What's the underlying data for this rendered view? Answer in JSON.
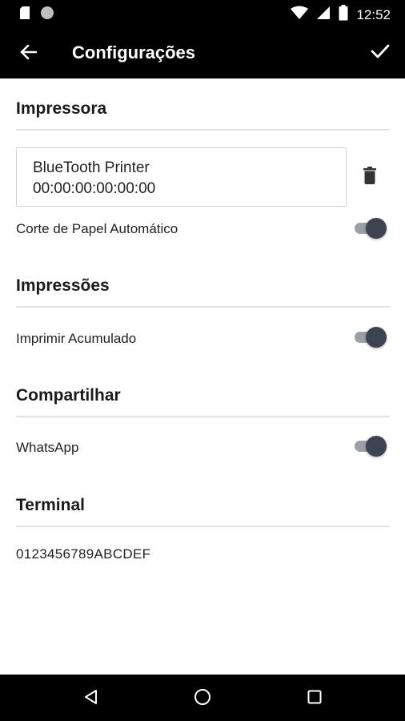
{
  "status_bar": {
    "time": "12:52",
    "icons": [
      "sd-card-icon",
      "circle-notification-icon",
      "wifi-icon",
      "signal-icon",
      "battery-icon"
    ]
  },
  "app_bar": {
    "title": "Configurações",
    "back_icon": "arrow-left-icon",
    "confirm_icon": "check-icon"
  },
  "sections": {
    "printer": {
      "title": "Impressora",
      "device_name": "BlueTooth Printer",
      "device_address": "00:00:00:00:00:00",
      "delete_icon": "trash-icon",
      "auto_cut_label": "Corte de Papel Automático",
      "auto_cut_enabled": true
    },
    "prints": {
      "title": "Impressões",
      "accumulated_label": "Imprimir Acumulado",
      "accumulated_enabled": true
    },
    "share": {
      "title": "Compartilhar",
      "whatsapp_label": "WhatsApp",
      "whatsapp_enabled": true
    },
    "terminal": {
      "title": "Terminal",
      "value": "0123456789ABCDEF"
    }
  },
  "nav_bar": {
    "icons": [
      "back-triangle-icon",
      "home-circle-icon",
      "recents-square-icon"
    ]
  },
  "colors": {
    "bars": "#000000",
    "toggle_thumb": "#3d4350",
    "toggle_track": "#9aa0a8",
    "divider": "#e3e3e3"
  }
}
